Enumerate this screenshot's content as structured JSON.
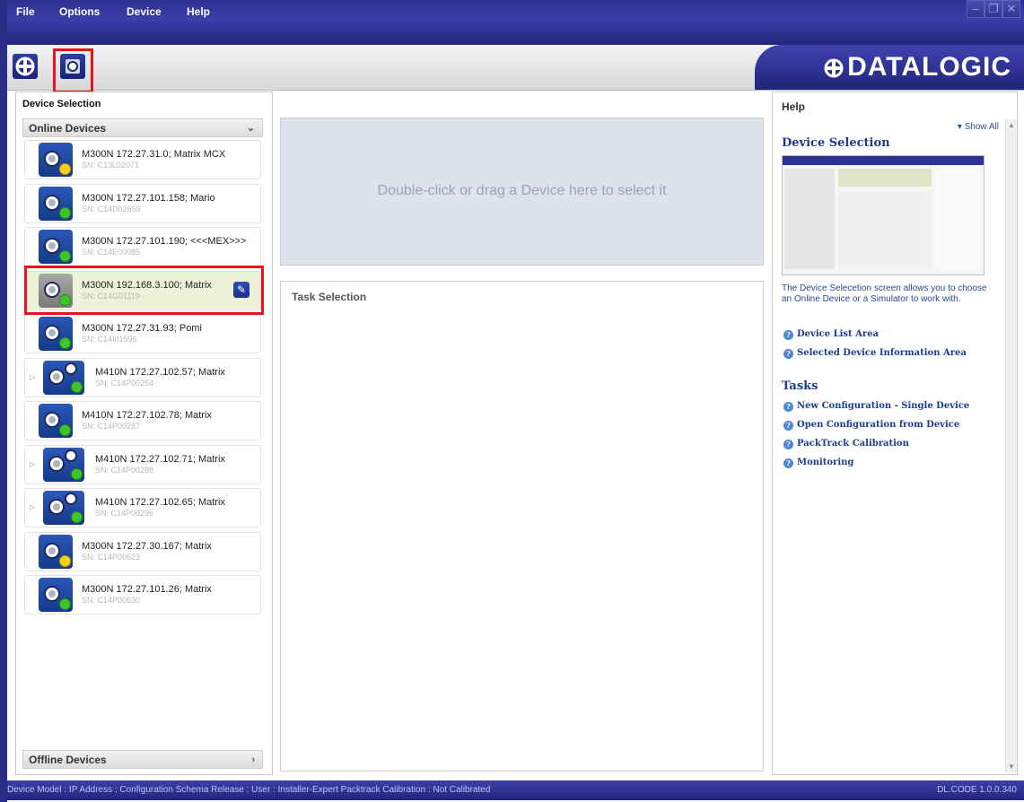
{
  "menu": {
    "items": [
      {
        "label": "File"
      },
      {
        "label": "Options"
      },
      {
        "label": "Device"
      },
      {
        "label": "Help"
      }
    ]
  },
  "toolbar": {
    "logo_text": "DATALOGIC",
    "buttons": [
      {
        "icon": "crosshair-icon"
      },
      {
        "icon": "device-select-icon"
      }
    ]
  },
  "left_panel": {
    "title": "Device Selection",
    "online_group": "Online Devices",
    "offline_group": "Offline Devices",
    "devices": [
      {
        "name": "M300N 172.27.31.0; Matrix MCX",
        "sn": "SN: C13L02071",
        "status": "yellow",
        "type": "single",
        "expandable": false,
        "selected": false
      },
      {
        "name": "M300N 172.27.101.158; Mario",
        "sn": "SN: C14D02659",
        "status": "green",
        "type": "single",
        "expandable": false,
        "selected": false
      },
      {
        "name": "M300N 172.27.101.190; <<<MEX>>>",
        "sn": "SN: C14E00085",
        "status": "green",
        "type": "single",
        "expandable": false,
        "selected": false
      },
      {
        "name": "M300N 192.168.3.100; Matrix",
        "sn": "SN: C14G01119",
        "status": "green",
        "type": "single",
        "expandable": false,
        "selected": true
      },
      {
        "name": "M300N 172.27.31.93; Pomi",
        "sn": "SN: C14I01596",
        "status": "green",
        "type": "single",
        "expandable": false,
        "selected": false
      },
      {
        "name": "M410N 172.27.102.57; Matrix",
        "sn": "SN: C14P00254",
        "status": "green",
        "type": "dual",
        "expandable": true,
        "selected": false
      },
      {
        "name": "M410N 172.27.102.78; Matrix",
        "sn": "SN: C14P00287",
        "status": "green",
        "type": "single",
        "expandable": false,
        "selected": false
      },
      {
        "name": "M410N 172.27.102.71; Matrix",
        "sn": "SN: C14P00288",
        "status": "green",
        "type": "dual",
        "expandable": true,
        "selected": false
      },
      {
        "name": "M410N 172.27.102.65; Matrix",
        "sn": "SN: C14P00296",
        "status": "green",
        "type": "dual",
        "expandable": true,
        "selected": false
      },
      {
        "name": "M300N 172.27.30.167; Matrix",
        "sn": "SN: C14P00623",
        "status": "yellow",
        "type": "single",
        "expandable": false,
        "selected": false
      },
      {
        "name": "M300N 172.27.101.26; Matrix",
        "sn": "SN: C14P00630",
        "status": "green",
        "type": "single",
        "expandable": false,
        "selected": false
      }
    ]
  },
  "center": {
    "drop_text": "Double-click or drag a Device here to select it",
    "task_title": "Task Selection"
  },
  "help": {
    "title": "Help",
    "show_all": "Show All",
    "heading": "Device Selection",
    "description": "The Device Selecetion screen allows you to choose an Online Device or a Simulator to work with.",
    "links": [
      {
        "label": "Device List Area"
      },
      {
        "label": "Selected Device Information Area"
      }
    ],
    "tasks_heading": "Tasks",
    "task_links": [
      {
        "label": "New Configuration - Single Device"
      },
      {
        "label": "Open Configuration from Device"
      },
      {
        "label": "PackTrack Calibration"
      },
      {
        "label": "Monitoring"
      }
    ]
  },
  "status": {
    "text": "Device Model :     IP Address :    Configuration Schema Release :    User : Installer-Expert   Packtrack Calibration : Not Calibrated",
    "version": "DL.CODE 1.0.0.340"
  },
  "colors": {
    "frame_blue": "#2a2d86",
    "highlight_red": "#e8141a",
    "status_green": "#3fc42a",
    "status_yellow": "#f4d01a"
  }
}
